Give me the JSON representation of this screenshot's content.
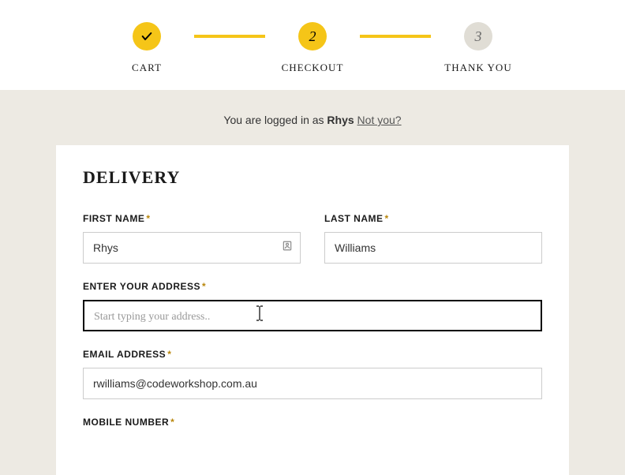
{
  "stepper": {
    "steps": [
      {
        "label": "CART",
        "state": "done"
      },
      {
        "label": "CHECKOUT",
        "state": "active",
        "num": "2"
      },
      {
        "label": "THANK YOU",
        "state": "pending",
        "num": "3"
      }
    ]
  },
  "logged_in": {
    "prefix": "You are logged in as ",
    "username": "Rhys",
    "not_you": "Not you?"
  },
  "delivery": {
    "title": "DELIVERY",
    "first_name": {
      "label": "FIRST NAME",
      "value": "Rhys"
    },
    "last_name": {
      "label": "LAST NAME",
      "value": "Williams"
    },
    "address": {
      "label": "ENTER YOUR ADDRESS",
      "placeholder": "Start typing your address..",
      "value": ""
    },
    "email": {
      "label": "EMAIL ADDRESS",
      "value": "rwilliams@codeworkshop.com.au"
    },
    "mobile": {
      "label": "MOBILE NUMBER"
    }
  },
  "required_mark": "*"
}
